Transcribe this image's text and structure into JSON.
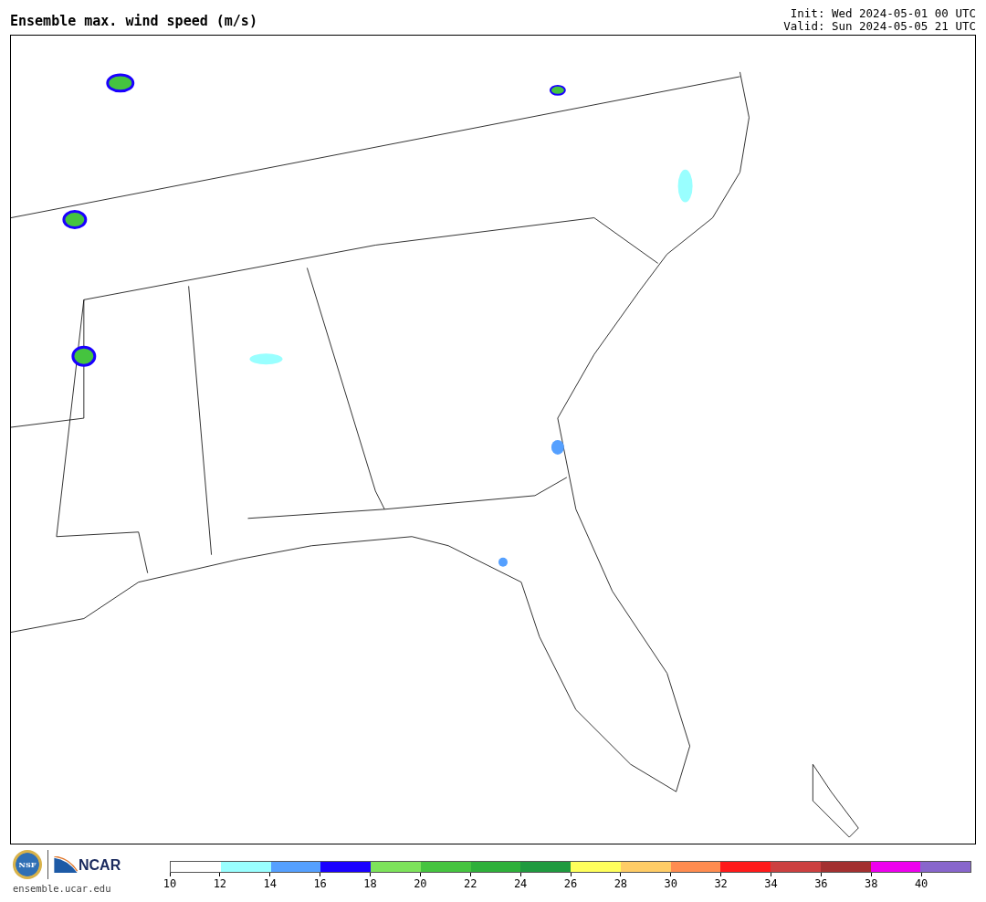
{
  "title": "Ensemble max. wind speed (m/s)",
  "run_info": [
    "Init: Wed 2024-05-01 00 UTC",
    "Valid: Sun 2024-05-05 21 UTC"
  ],
  "logos": {
    "nsf": "NSF",
    "ncar": "NCAR",
    "url": "ensemble.ucar.edu"
  },
  "colorbar": {
    "segments": [
      {
        "color": "#ffffff"
      },
      {
        "color": "#99ffff"
      },
      {
        "color": "#55a0ff"
      },
      {
        "color": "#1a00ff"
      },
      {
        "color": "#7de35a"
      },
      {
        "color": "#45c43f"
      },
      {
        "color": "#2eb03a"
      },
      {
        "color": "#1f9a3f"
      },
      {
        "color": "#ffff5c"
      },
      {
        "color": "#ffcc66"
      },
      {
        "color": "#ff8c50"
      },
      {
        "color": "#ff1a1a"
      },
      {
        "color": "#cc4040"
      },
      {
        "color": "#a33030"
      },
      {
        "color": "#ee00ee"
      },
      {
        "color": "#8866cc"
      }
    ],
    "ticks": [
      "10",
      "12",
      "14",
      "16",
      "18",
      "20",
      "22",
      "24",
      "26",
      "28",
      "30",
      "32",
      "34",
      "36",
      "38",
      "40"
    ]
  }
}
